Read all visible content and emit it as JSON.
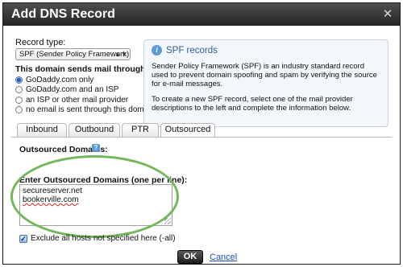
{
  "dialog": {
    "title": "Add DNS Record",
    "close_label": "✕"
  },
  "record_type": {
    "label": "Record type:",
    "selected": "SPF (Sender Policy Framework)"
  },
  "mail_through": {
    "heading": "This domain sends mail through...",
    "options": [
      {
        "label": "GoDaddy.com only",
        "checked": true
      },
      {
        "label": "GoDaddy.com and an ISP",
        "checked": false
      },
      {
        "label": "an ISP or other mail provider",
        "checked": false
      },
      {
        "label": "no email is sent through this domain",
        "checked": false
      }
    ]
  },
  "info": {
    "icon": "i",
    "title": "SPF records",
    "p1": "Sender Policy Framework (SPF) is an industry standard record used to prevent domain spoofing and spam by verifying the source for e-mail messages.",
    "p2": "To create a new SPF record, select one of the mail provider descriptions to the left and complete the information below."
  },
  "tabs": [
    {
      "label": "Inbound",
      "active": false
    },
    {
      "label": "Outbound",
      "active": false
    },
    {
      "label": "PTR",
      "active": false
    },
    {
      "label": "Outsourced",
      "active": true
    }
  ],
  "outsourced": {
    "label": "Outsourced Domains:",
    "help_icon": "?",
    "enter_label": "Enter Outsourced Domains (one per line):",
    "domains": [
      "secureserver.net",
      "bookerville.com"
    ]
  },
  "exclude": {
    "label": "Exclude all hosts not specified here (-all)",
    "checked": true,
    "mark": "✓"
  },
  "buttons": {
    "ok": "OK",
    "cancel": "Cancel"
  },
  "colors": {
    "titlebar": "#262626",
    "highlight": "#72b85a",
    "link": "#1a4fb3",
    "info_accent": "#2a5d9a"
  }
}
